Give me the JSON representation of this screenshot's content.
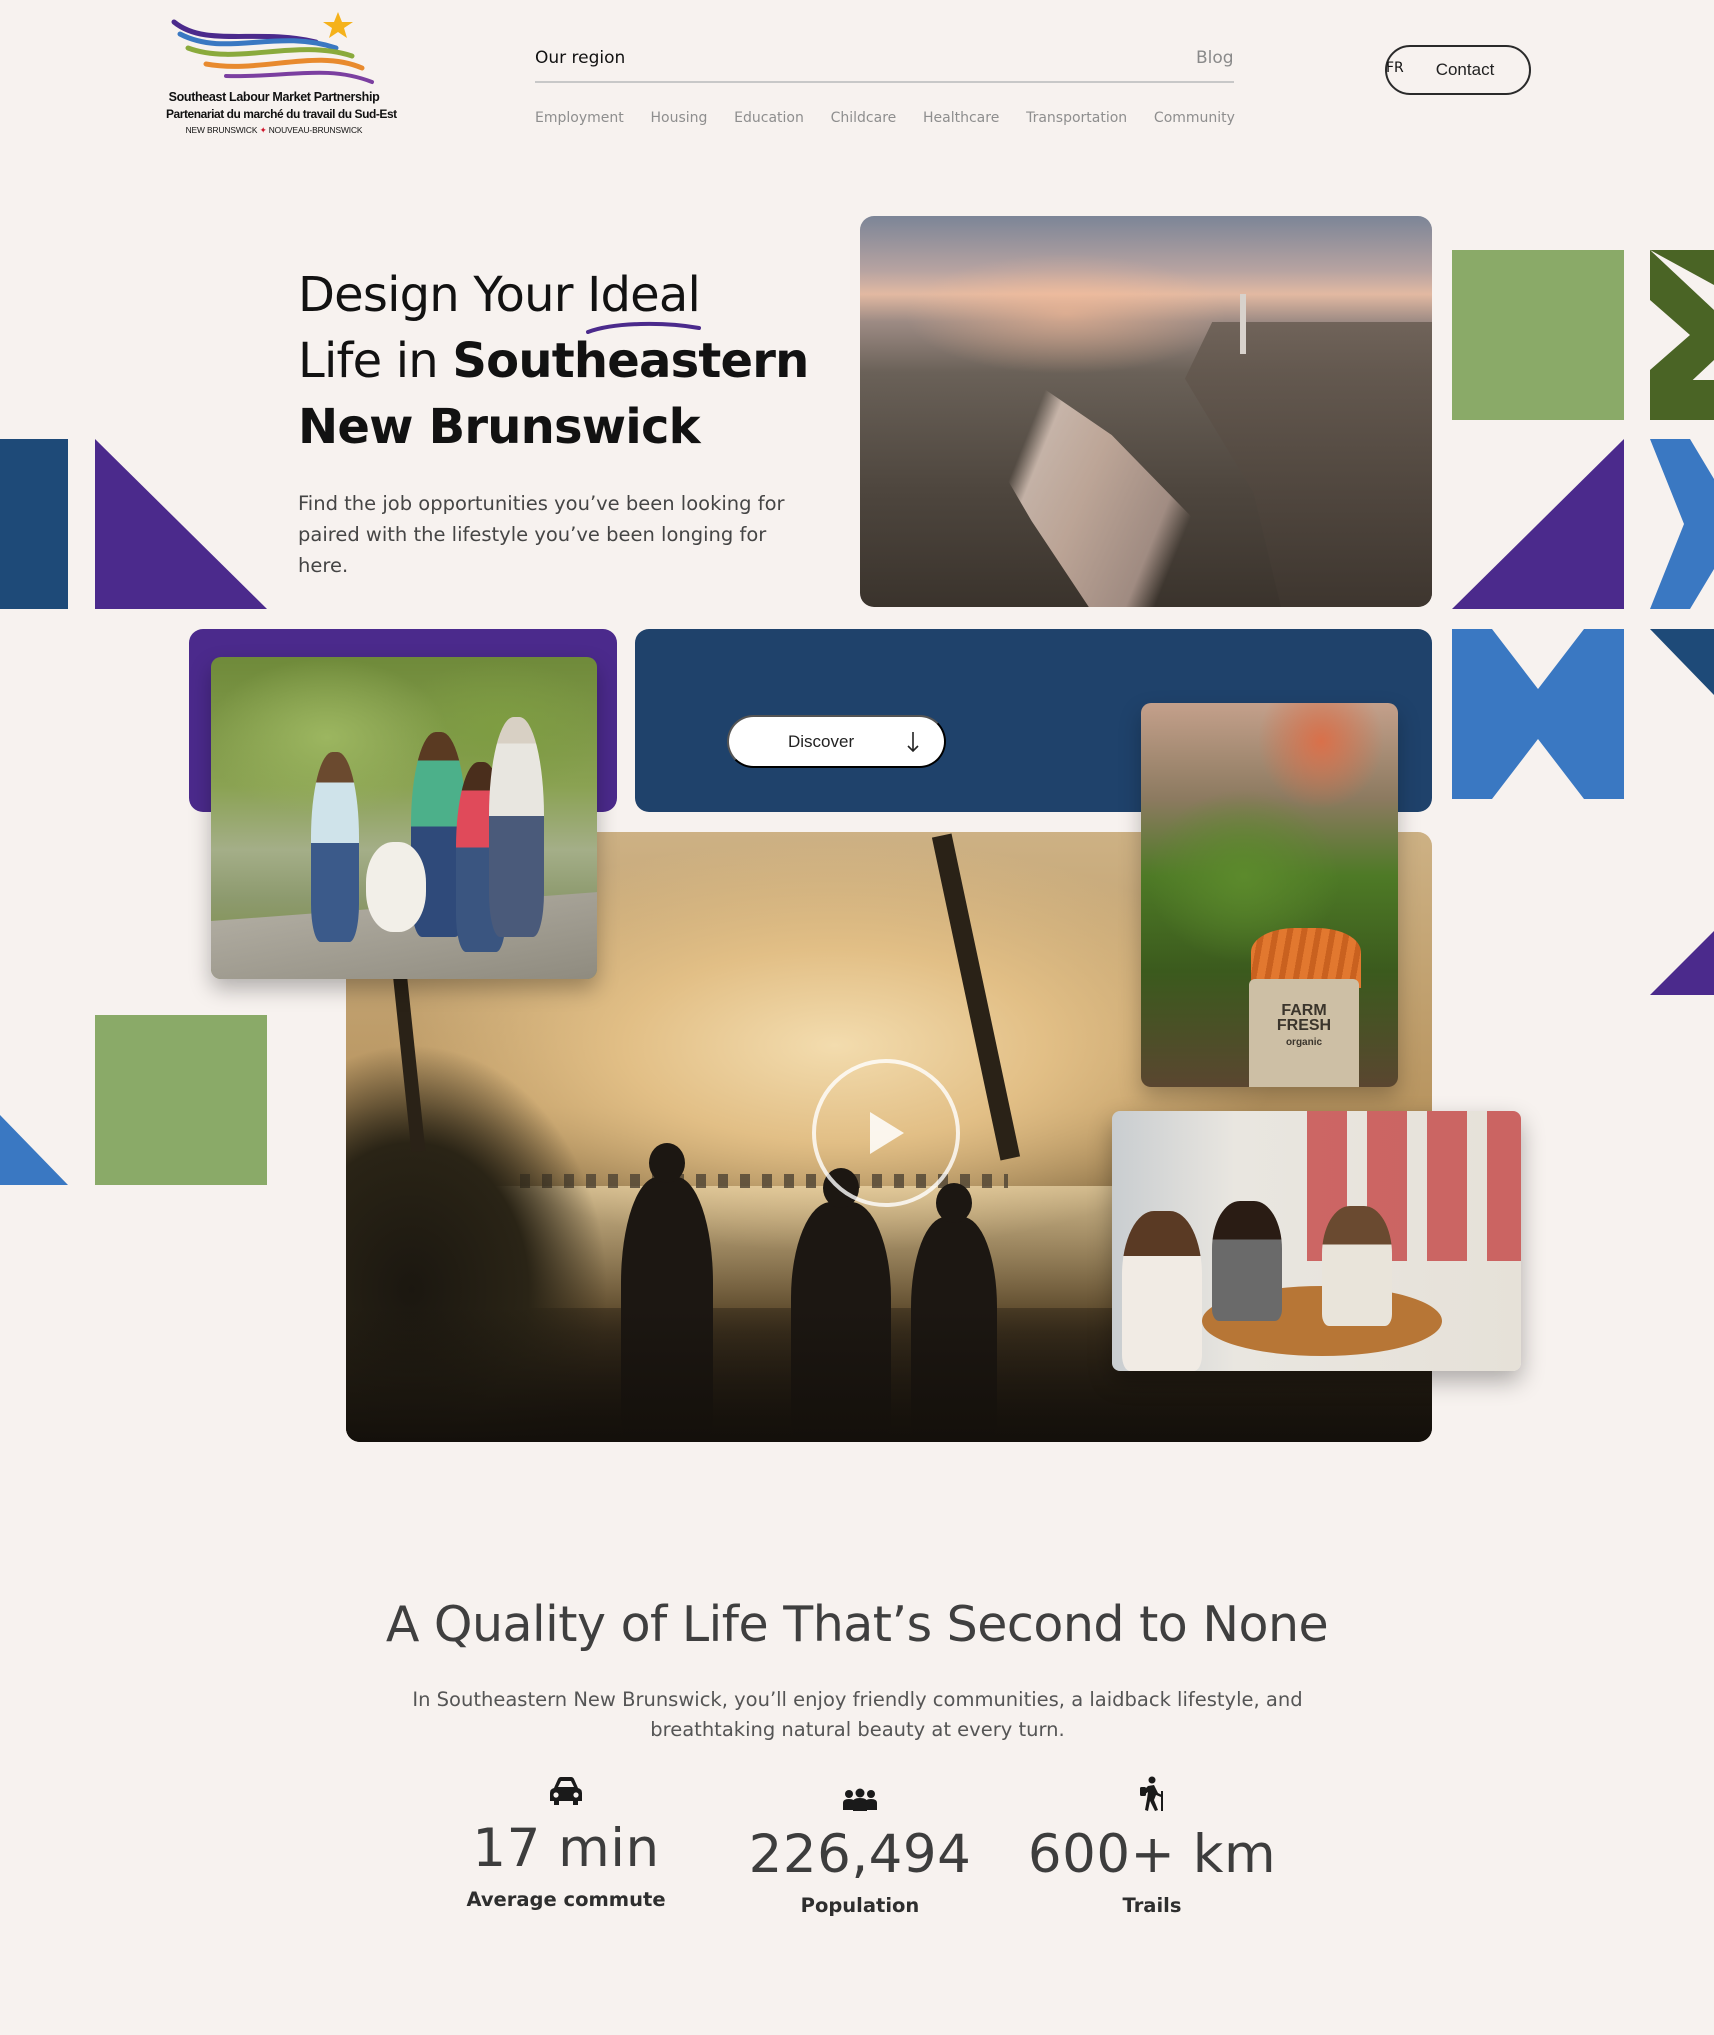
{
  "logo": {
    "line1": "Southeast Labour Market Partnership",
    "line2": "Partenariat du marché du travail du Sud-Est",
    "line3_left": "NEW BRUNSWICK",
    "line3_right": "NOUVEAU-BRUNSWICK"
  },
  "nav": {
    "primary": "Our region",
    "blog": "Blog",
    "sub_items": [
      "Employment",
      "Housing",
      "Education",
      "Childcare",
      "Healthcare",
      "Transportation",
      "Community"
    ],
    "lang": "FR",
    "contact": "Contact"
  },
  "hero": {
    "title_part1": "Design Your ",
    "title_highlight": "Ideal",
    "title_part2": "Life in ",
    "title_bold1": "Southeastern",
    "title_bold2": "New Brunswick",
    "subtitle": "Find the job opportunities you’ve been looking for paired with the lifestyle you’ve been longing for here.",
    "discover": "Discover",
    "market_bag_line1": "FARM",
    "market_bag_line2": "FRESH",
    "market_bag_line3": "organic"
  },
  "quality": {
    "title": "A Quality of Life That’s Second to None",
    "subtitle": "In Southeastern New Brunswick, you’ll enjoy friendly communities, a laidback lifestyle, and breathtaking natural beauty at every turn.",
    "stats": [
      {
        "icon": "car-icon",
        "value": "17 min",
        "label": "Average commute"
      },
      {
        "icon": "people-icon",
        "value": "226,494",
        "label": "Population"
      },
      {
        "icon": "hiker-icon",
        "value": "600+ km",
        "label": "Trails"
      }
    ]
  },
  "colors": {
    "background": "#f7f2ef",
    "purple": "#4b2a8c",
    "navy": "#1f426b",
    "green": "#8aaa68",
    "dark_green": "#4a6425",
    "blue": "#3a78c2",
    "deep_blue": "#1e4a78"
  }
}
